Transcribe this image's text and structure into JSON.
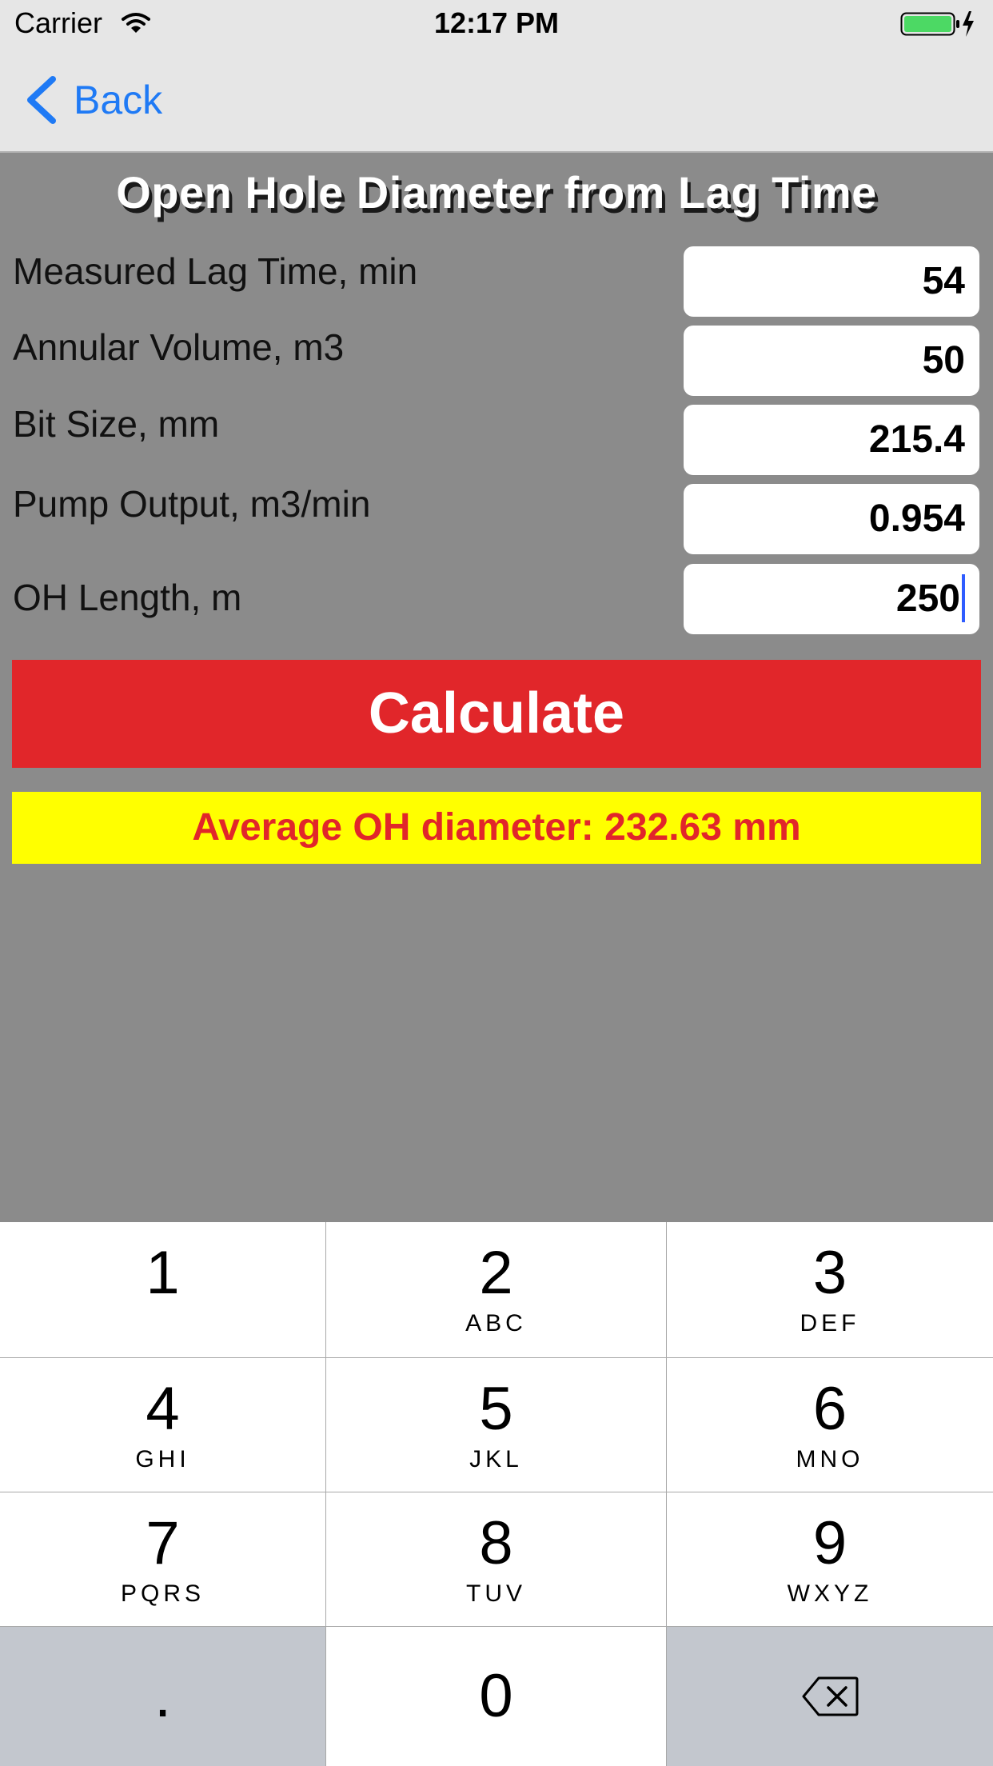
{
  "status_bar": {
    "carrier": "Carrier",
    "time": "12:17 PM",
    "icons": [
      "wifi-icon",
      "battery-icon"
    ],
    "battery_color": "#4cd964"
  },
  "nav": {
    "back_label": "Back",
    "accent_color": "#1f7af5"
  },
  "page": {
    "title": "Open Hole Diameter from Lag Time"
  },
  "fields": [
    {
      "label": "Measured Lag Time, min",
      "value": "54"
    },
    {
      "label": "Annular Volume, m3",
      "value": "50"
    },
    {
      "label": "Bit Size, mm",
      "value": "215.4"
    },
    {
      "label": "Pump Output, m3/min",
      "value": "0.954"
    },
    {
      "label": "OH Length, m",
      "value": "250"
    }
  ],
  "calculate": {
    "label": "Calculate",
    "color": "#e1262a"
  },
  "result": {
    "text": "Average OH diameter: 232.63 mm",
    "background": "#ffff00",
    "text_color": "#e1262a"
  },
  "keypad": {
    "keys": [
      {
        "digit": "1",
        "letters": ""
      },
      {
        "digit": "2",
        "letters": "ABC"
      },
      {
        "digit": "3",
        "letters": "DEF"
      },
      {
        "digit": "4",
        "letters": "GHI"
      },
      {
        "digit": "5",
        "letters": "JKL"
      },
      {
        "digit": "6",
        "letters": "MNO"
      },
      {
        "digit": "7",
        "letters": "PQRS"
      },
      {
        "digit": "8",
        "letters": "TUV"
      },
      {
        "digit": "9",
        "letters": "WXYZ"
      }
    ],
    "decimal": ".",
    "zero": "0",
    "delete_icon": "backspace-icon"
  }
}
